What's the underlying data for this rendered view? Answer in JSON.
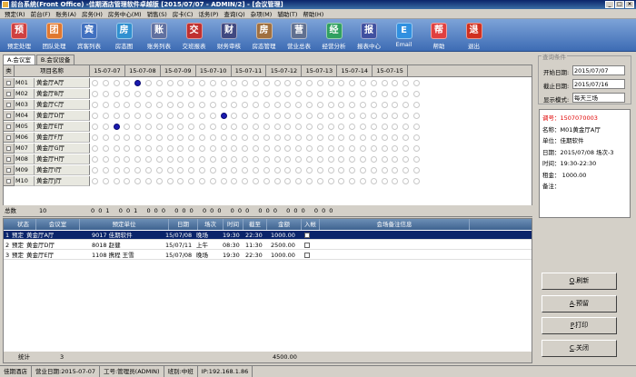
{
  "window": {
    "title": "前台系统(Front Office) -佳期酒店管理软件卓越版 [2015/07/07 - ADMIN/2] - [会议管理]"
  },
  "menu": [
    "预定(R)",
    "前台(F)",
    "账务(A)",
    "房务(H)",
    "房务中心(M)",
    "销售(S)",
    "房卡(C)",
    "话务(P)",
    "查询(Q)",
    "杂项(M)",
    "辅助(T)",
    "帮助(H)"
  ],
  "toolbar": [
    {
      "label": "预定处理",
      "icon": "reserve-icon",
      "color": "#d04040"
    },
    {
      "label": "团队处理",
      "icon": "group-icon",
      "color": "#e07830"
    },
    {
      "label": "宾客列表",
      "icon": "guest-icon",
      "color": "#4070c0"
    },
    {
      "label": "房态图",
      "icon": "room-map-icon",
      "color": "#3090d0"
    },
    {
      "label": "账务列表",
      "icon": "account-icon",
      "color": "#6070a0"
    },
    {
      "label": "交班报表",
      "icon": "shift-icon",
      "color": "#c03030"
    },
    {
      "label": "财务审核",
      "icon": "audit-icon",
      "color": "#404880"
    },
    {
      "label": "房态管理",
      "icon": "room-icon",
      "color": "#a07040"
    },
    {
      "label": "营业总表",
      "icon": "sales-icon",
      "color": "#607090"
    },
    {
      "label": "经营分析",
      "icon": "analysis-icon",
      "color": "#30a060"
    },
    {
      "label": "报表中心",
      "icon": "report-icon",
      "color": "#4050a0"
    },
    {
      "label": "Email",
      "icon": "email-icon",
      "color": "#3090e0"
    },
    {
      "label": "帮助",
      "icon": "help-icon",
      "color": "#e04040"
    },
    {
      "label": "退出",
      "icon": "exit-icon",
      "color": "#d03020"
    }
  ],
  "tabs": [
    "A.会议室",
    "B.会议设备"
  ],
  "grid": {
    "col_type": "类",
    "col_name": "项目名称",
    "dates": [
      "15-07-07",
      "15-07-08",
      "15-07-09",
      "15-07-10",
      "15-07-11",
      "15-07-12",
      "15-07-13",
      "15-07-14",
      "15-07-15"
    ],
    "rooms": [
      {
        "code": "M01",
        "name": "黄金厅A厅",
        "booked": [
          4
        ]
      },
      {
        "code": "M02",
        "name": "黄金厅B厅",
        "booked": []
      },
      {
        "code": "M03",
        "name": "黄金厅C厅",
        "booked": []
      },
      {
        "code": "M04",
        "name": "黄金厅D厅",
        "booked": [
          12
        ]
      },
      {
        "code": "M05",
        "name": "黄金厅E厅",
        "booked": [
          2
        ]
      },
      {
        "code": "M06",
        "name": "黄金厅F厅",
        "booked": []
      },
      {
        "code": "M07",
        "name": "黄金厅G厅",
        "booked": []
      },
      {
        "code": "M08",
        "name": "黄金厅H厅",
        "booked": []
      },
      {
        "code": "M09",
        "name": "黄金厅I厅",
        "booked": []
      },
      {
        "code": "M10",
        "name": "黄金厅J厅",
        "booked": []
      }
    ],
    "total_label": "总数",
    "total_value": "10",
    "summary_counts": "0 0 1   0 0 1   0 0 0   0 0 0   0 0 0   0 0 0   0 0 0   0 0 0   0 0 0"
  },
  "list": {
    "headers": [
      "状态",
      "会议室",
      "预定单位",
      "日期",
      "场次",
      "时间",
      "截至",
      "金额",
      "入帐",
      "会场备注信息"
    ],
    "rows": [
      {
        "no": "1",
        "status": "预定",
        "room": "黄金厅A厅",
        "unit": "9017 佳期软件",
        "date": "15/07/08",
        "session": "晚场",
        "time": "19:30",
        "end": "22:30",
        "amount": "1000.00",
        "posted": ""
      },
      {
        "no": "2",
        "status": "预定",
        "room": "黄金厅D厅",
        "unit": "8018 赵健",
        "date": "15/07/11",
        "session": "上午",
        "time": "08:30",
        "end": "11:30",
        "amount": "2500.00",
        "posted": ""
      },
      {
        "no": "3",
        "status": "预定",
        "room": "黄金厅E厅",
        "unit": "1108 携程 王雪",
        "date": "15/07/08",
        "session": "晚场",
        "time": "19:30",
        "end": "22:30",
        "amount": "1000.00",
        "posted": ""
      }
    ],
    "foot_label": "统计",
    "foot_count": "3",
    "foot_amount": "4500.00"
  },
  "query": {
    "legend": "查询条件",
    "start_label": "开始日期:",
    "start_value": "2015/07/07",
    "end_label": "截止日期:",
    "end_value": "2015/07/16",
    "mode_label": "显示模式:",
    "mode_value": "每天三场"
  },
  "info": {
    "order": "调号：1507070003",
    "name": "名称：M01黄金厅A厅",
    "unit": "单位：佳期软件",
    "date": "日期：2015/07/08 场次-3",
    "time": "时间：19:30-22:30",
    "rent": "租金：    1000.00",
    "note": "备注："
  },
  "actions": [
    {
      "key": "O",
      "label": ".刷新"
    },
    {
      "key": "A",
      "label": ".预留"
    },
    {
      "key": "P",
      "label": ".打印"
    },
    {
      "key": "C",
      "label": ".关闭"
    }
  ],
  "status": [
    "佳期酒店",
    "营业日期:2015-07-07",
    "工号:管理员(ADMIN)",
    "班别:中班",
    "IP:192.168.1.86"
  ]
}
